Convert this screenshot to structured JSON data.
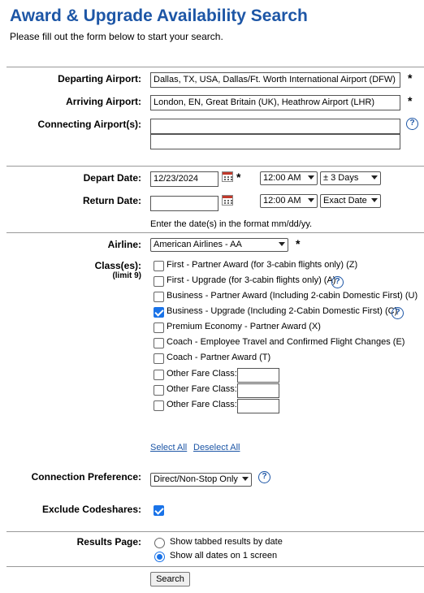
{
  "header": {
    "title": "Award & Upgrade Availability Search",
    "subtitle": "Please fill out the form below to start your search."
  },
  "airports": {
    "departing_label": "Departing Airport:",
    "departing_value": "Dallas, TX, USA, Dallas/Ft. Worth International Airport (DFW)",
    "arriving_label": "Arriving Airport:",
    "arriving_value": "London, EN, Great Britain (UK), Heathrow Airport (LHR)",
    "connecting_label": "Connecting Airport(s):",
    "connecting_value_1": "",
    "connecting_value_2": ""
  },
  "required_mark": "*",
  "help_glyph": "?",
  "dates": {
    "depart_label": "Depart Date:",
    "depart_value": "12/23/2024",
    "depart_time": "12:00 AM",
    "depart_range": "± 3 Days",
    "return_label": "Return Date:",
    "return_value": "",
    "return_time": "12:00 AM",
    "return_range": "Exact Date",
    "format_note": "Enter the date(s) in the format mm/dd/yy."
  },
  "airline": {
    "label": "Airline:",
    "value": "American Airlines - AA"
  },
  "classes": {
    "label": "Class(es):",
    "limit": "(limit 9)",
    "items": [
      {
        "text": "First - Partner Award (for 3-cabin flights only) (Z)",
        "checked": false,
        "help": false
      },
      {
        "text": "First - Upgrade (for 3-cabin flights only) (A)",
        "checked": false,
        "help": true
      },
      {
        "text": "Business - Partner Award (Including 2-cabin Domestic First) (U)",
        "checked": false,
        "help": false
      },
      {
        "text": "Business - Upgrade (Including 2-Cabin Domestic First) (C)",
        "checked": true,
        "help": true
      },
      {
        "text": "Premium Economy - Partner Award (X)",
        "checked": false,
        "help": false
      },
      {
        "text": "Coach - Employee Travel and Confirmed Flight Changes (E)",
        "checked": false,
        "help": false
      },
      {
        "text": "Coach - Partner Award (T)",
        "checked": false,
        "help": false
      }
    ],
    "other_fare_label": "Other Fare Class:",
    "select_all": "Select All",
    "deselect_all": "Deselect All"
  },
  "connection": {
    "label": "Connection Preference:",
    "value": "Direct/Non-Stop Only"
  },
  "codeshares": {
    "label": "Exclude Codeshares:",
    "checked": true
  },
  "results": {
    "label": "Results Page:",
    "option_tabbed": "Show tabbed results by date",
    "option_all": "Show all dates on 1 screen",
    "selected": "all"
  },
  "search_button": "Search"
}
